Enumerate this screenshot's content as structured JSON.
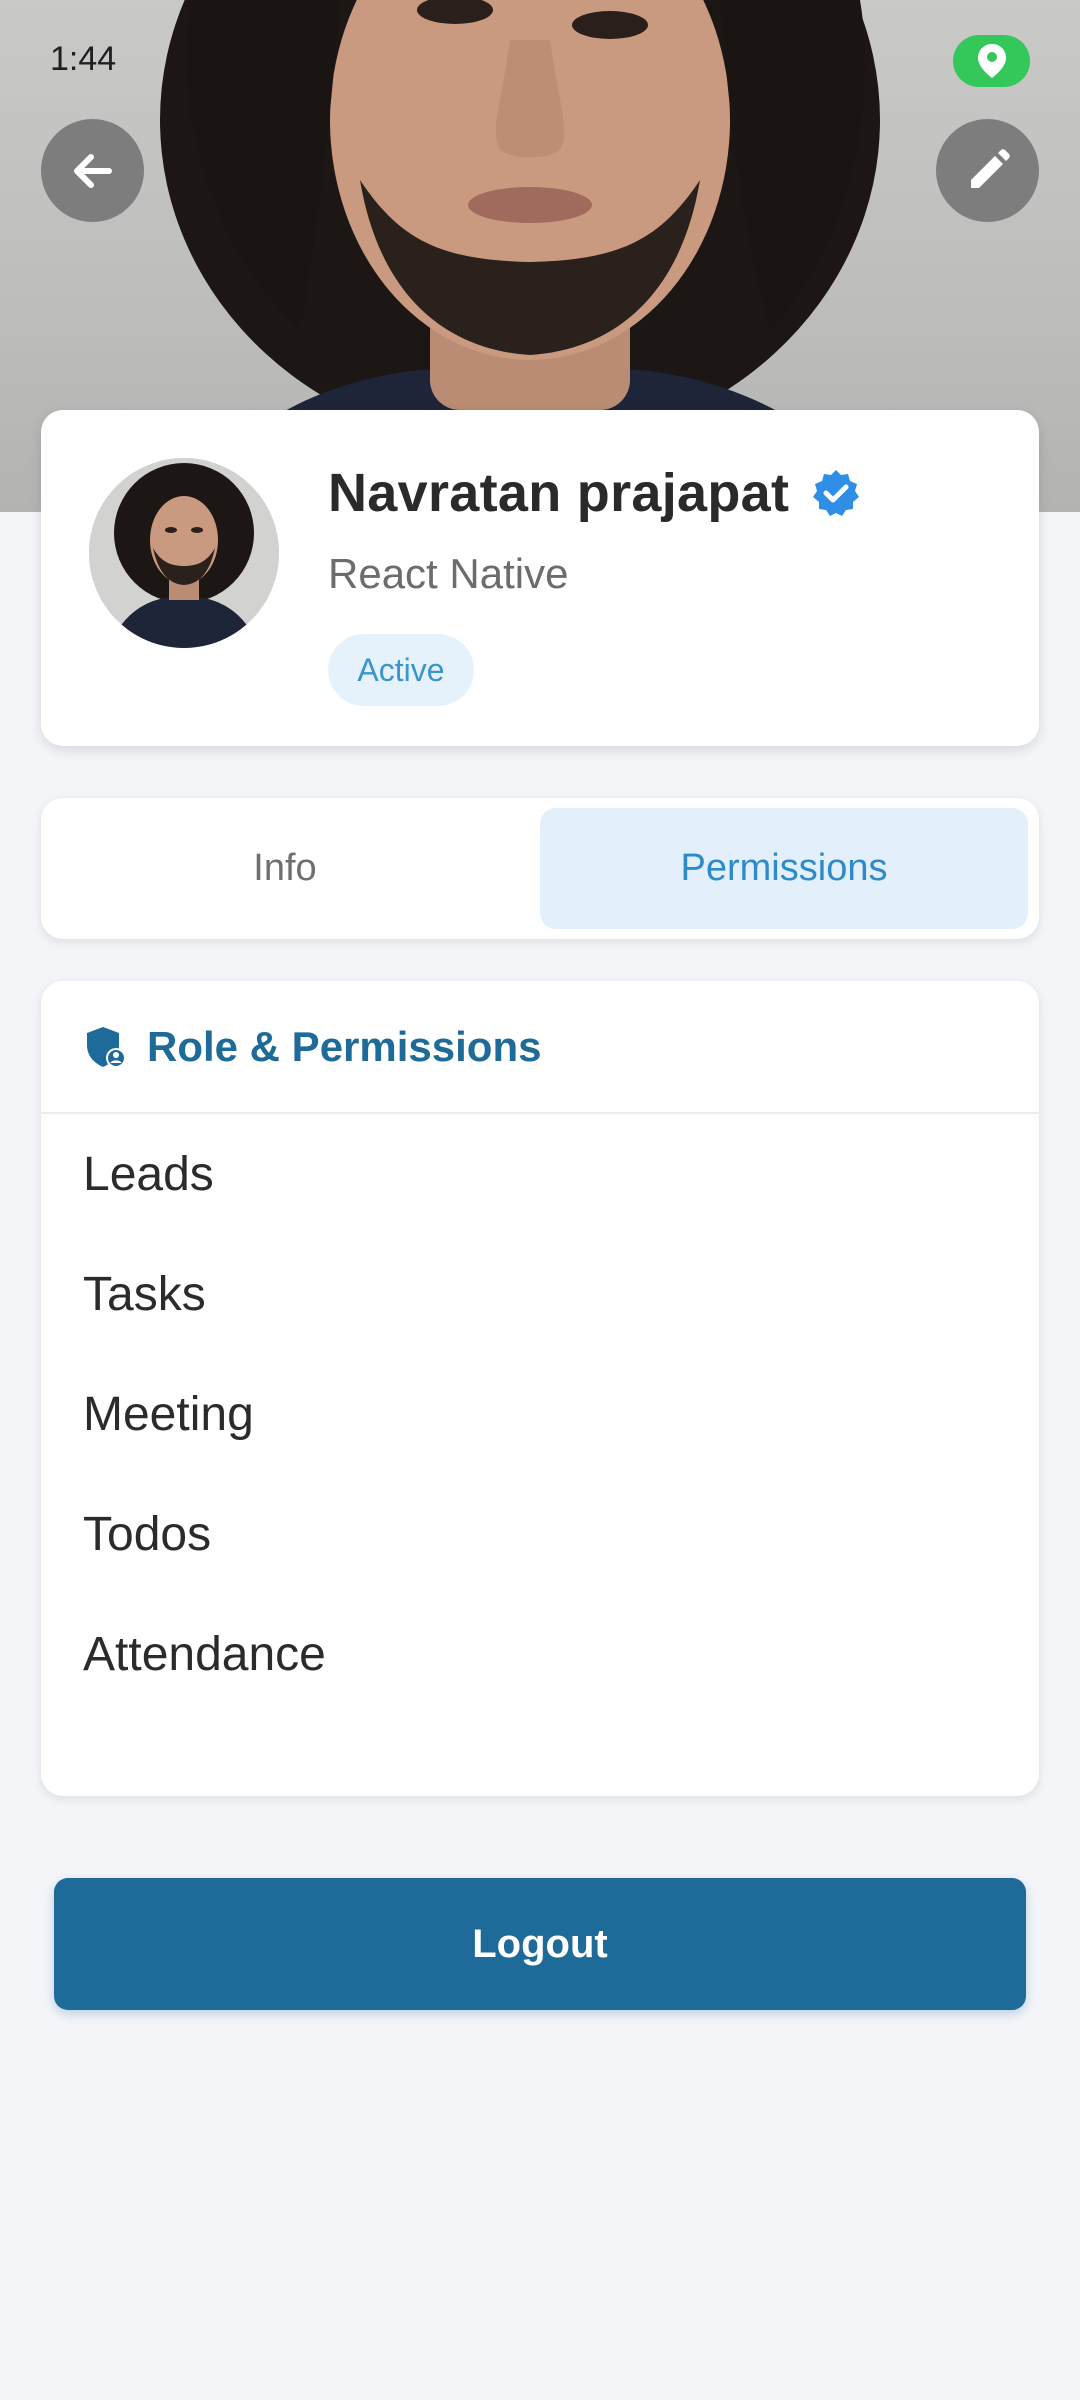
{
  "status_bar": {
    "time": "1:44"
  },
  "header": {
    "back_icon": "arrow-left-icon",
    "edit_icon": "pencil-icon",
    "location_icon": "location-pin-icon"
  },
  "profile": {
    "name": "Navratan prajapat",
    "role": "React Native",
    "status": "Active",
    "verified_icon": "verified-badge-icon"
  },
  "tabs": [
    {
      "label": "Info",
      "active": false
    },
    {
      "label": "Permissions",
      "active": true
    }
  ],
  "permissions": {
    "title": "Role & Permissions",
    "icon": "shield-user-icon",
    "items": [
      "Leads",
      "Tasks",
      "Meeting",
      "Todos",
      "Attendance"
    ]
  },
  "logout_label": "Logout",
  "colors": {
    "primary": "#1e6a98",
    "accent": "#2e8bc9",
    "verified": "#2f8fe6",
    "location_pill": "#34c759",
    "background": "#f3f5f9"
  }
}
